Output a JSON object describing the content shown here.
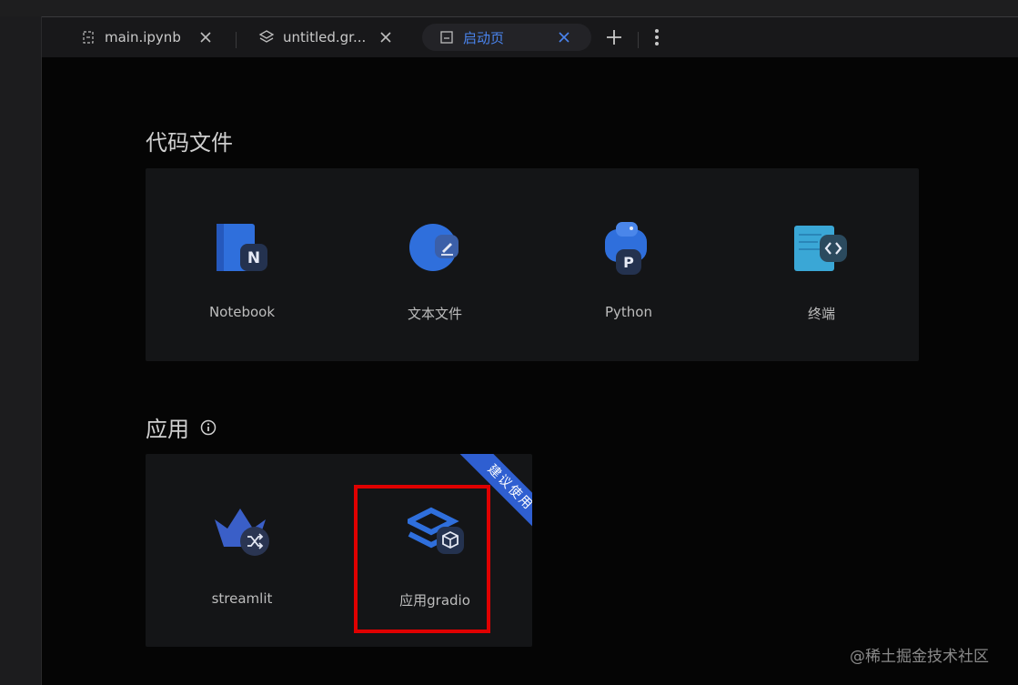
{
  "tabs": [
    {
      "label": "main.ipynb",
      "icon": "notebook-file-icon",
      "active": false
    },
    {
      "label": "untitled.gr...",
      "icon": "gradio-file-icon",
      "active": false
    },
    {
      "label": "启动页",
      "icon": "launcher-icon",
      "active": true
    }
  ],
  "sections": {
    "code": {
      "title": "代码文件",
      "items": [
        {
          "label": "Notebook",
          "icon": "notebook-icon"
        },
        {
          "label": "文本文件",
          "icon": "text-file-icon"
        },
        {
          "label": "Python",
          "icon": "python-icon"
        },
        {
          "label": "终端",
          "icon": "terminal-icon"
        }
      ]
    },
    "apps": {
      "title": "应用",
      "items": [
        {
          "label": "streamlit",
          "icon": "streamlit-icon"
        },
        {
          "label": "应用gradio",
          "icon": "gradio-icon"
        }
      ],
      "ribbon": "建议使用"
    }
  },
  "watermark": "@稀土掘金技术社区",
  "colors": {
    "accent": "#4a84ee",
    "ribbon": "#2f5fd1",
    "highlight": "#e00000"
  }
}
